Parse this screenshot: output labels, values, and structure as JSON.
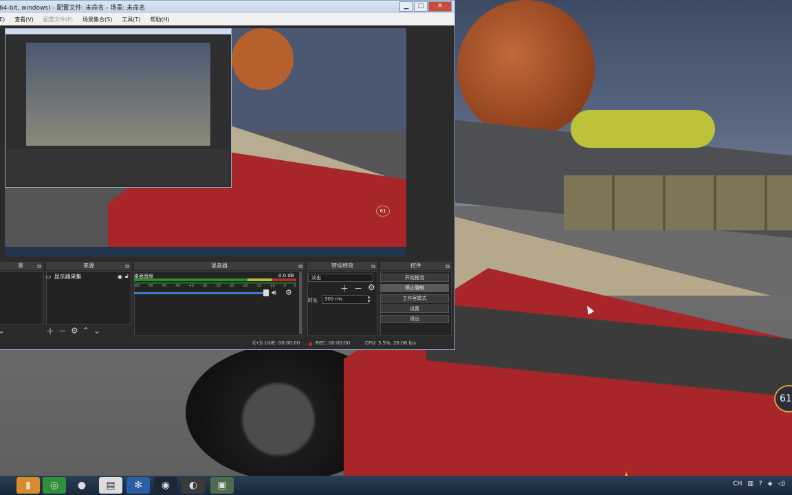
{
  "window": {
    "title": "64-bit, windows) - 配置文件: 未命名 - 场景: 未命名",
    "minimize": "▁",
    "maximize": "□",
    "close": "✕"
  },
  "menu": {
    "items": [
      "E)",
      "查看(V)",
      "配置文件(P)",
      "场景集合(S)",
      "工具(T)",
      "帮助(H)"
    ]
  },
  "docks": {
    "scenes_title": "景",
    "sources_title": "来源",
    "mixer_title": "混音器",
    "transitions_title": "转场特效",
    "controls_title": "控件"
  },
  "sources": {
    "items": [
      {
        "name": "显示器采集",
        "icon": "monitor-icon"
      }
    ]
  },
  "mixer": {
    "channel": "桌面音频",
    "db": "0.0 dB",
    "scale": [
      "-60",
      "-55",
      "-50",
      "-45",
      "-40",
      "-35",
      "-30",
      "-25",
      "-20",
      "-15",
      "-10",
      "-5",
      "0"
    ]
  },
  "transitions": {
    "selected": "淡出",
    "duration_label": "时长",
    "duration_value": "300 ms"
  },
  "controls": {
    "buttons": [
      "开始推流",
      "停止录制",
      "工作室模式",
      "设置",
      "退出"
    ],
    "active_index": 1
  },
  "status": {
    "live": "LIVE: 00:00:00",
    "rec": "REC: 00:00:00",
    "cpu": "CPU: 3.5%, 28.06 fps"
  },
  "game": {
    "speed": "61",
    "preview_speed": "61"
  },
  "taskbar": {
    "icons": [
      "folder-icon",
      "globe-icon",
      "qq-penguin-icon",
      "document-icon",
      "bluetooth-icon",
      "steam-icon",
      "obs-icon",
      "game-icon"
    ],
    "tray_lang": "CH"
  },
  "colors": {
    "obs_bg": "#2b2b2b",
    "car_red": "#a8262a",
    "volume_blue": "#3d7bd0",
    "rec_red": "#d42828"
  }
}
